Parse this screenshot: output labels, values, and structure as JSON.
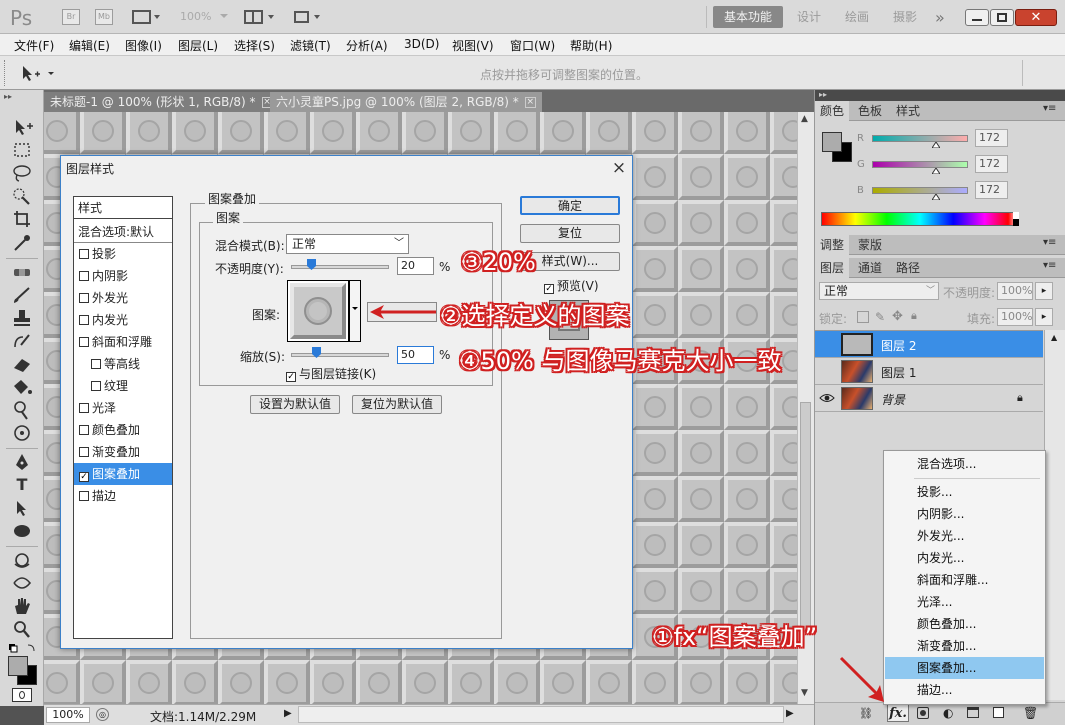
{
  "app": {
    "logo": "Ps",
    "top_buttons": [
      "Br",
      "Mb"
    ],
    "zoom_combo": "100%",
    "workspaces": [
      "基本功能",
      "设计",
      "绘画",
      "摄影"
    ],
    "workspace_more": "»"
  },
  "menu": [
    "文件(F)",
    "编辑(E)",
    "图像(I)",
    "图层(L)",
    "选择(S)",
    "滤镜(T)",
    "分析(A)",
    "3D(D)",
    "视图(V)",
    "窗口(W)",
    "帮助(H)"
  ],
  "options_bar": {
    "hint": "点按并拖移可调整图案的位置。"
  },
  "doc_tabs": [
    {
      "label": "未标题-1 @ 100% (形状 1, RGB/8) *",
      "close": "×"
    },
    {
      "label": "六小灵童PS.jpg @ 100% (图层 2, RGB/8) *",
      "close": "×"
    }
  ],
  "status": {
    "zoom": "100%",
    "doc": "文档:1.14M/2.29M"
  },
  "color_panel": {
    "tabs": [
      "颜色",
      "色板",
      "样式"
    ],
    "channels": [
      {
        "label": "R",
        "value": "172",
        "position": 0.67
      },
      {
        "label": "G",
        "value": "172",
        "position": 0.67
      },
      {
        "label": "B",
        "value": "172",
        "position": 0.67
      }
    ],
    "colors": {
      "foreground": "#acacac",
      "background": "#000000"
    }
  },
  "adjust_panel": {
    "tabs": [
      "调整",
      "蒙版"
    ]
  },
  "layers_panel": {
    "tabs": [
      "图层",
      "通道",
      "路径"
    ],
    "blend_mode": "正常",
    "opacity_label": "不透明度:",
    "opacity": "100%",
    "lock_label": "锁定:",
    "fill_label": "填充:",
    "fill": "100%",
    "layers": [
      {
        "name": "图层 2",
        "selected": true
      },
      {
        "name": "图层 1",
        "selected": false
      },
      {
        "name": "背景",
        "selected": false
      }
    ],
    "fx_label": "fx."
  },
  "context_menu": {
    "items": [
      "混合选项...",
      "投影...",
      "内阴影...",
      "外发光...",
      "内发光...",
      "斜面和浮雕...",
      "光泽...",
      "颜色叠加...",
      "渐变叠加...",
      "图案叠加...",
      "描边..."
    ],
    "highlighted": "图案叠加..."
  },
  "dialog": {
    "title": "图层样式",
    "close": "×",
    "styles_header": "样式",
    "styles": [
      {
        "label": "混合选项:默认",
        "check": false,
        "indent": 0
      },
      {
        "label": "投影",
        "check": true,
        "indent": 0
      },
      {
        "label": "内阴影",
        "check": true,
        "indent": 0
      },
      {
        "label": "外发光",
        "check": true,
        "indent": 0
      },
      {
        "label": "内发光",
        "check": true,
        "indent": 0
      },
      {
        "label": "斜面和浮雕",
        "check": true,
        "indent": 0
      },
      {
        "label": "等高线",
        "check": true,
        "indent": 1
      },
      {
        "label": "纹理",
        "check": true,
        "indent": 1
      },
      {
        "label": "光泽",
        "check": true,
        "indent": 0
      },
      {
        "label": "颜色叠加",
        "check": true,
        "indent": 0
      },
      {
        "label": "渐变叠加",
        "check": true,
        "indent": 0
      },
      {
        "label": "图案叠加",
        "check": true,
        "indent": 0,
        "checked": true,
        "selected": true
      },
      {
        "label": "描边",
        "check": true,
        "indent": 0
      }
    ],
    "group_title": "图案叠加",
    "sub_group": "图案",
    "blend_label": "混合模式(B):",
    "blend_value": "正常",
    "opacity_label": "不透明度(Y):",
    "opacity_value": "20",
    "opacity_unit": "%",
    "opacity_pct": 0.2,
    "pattern_label": "图案:",
    "scale_label": "缩放(S):",
    "scale_value": "50",
    "scale_unit": "%",
    "scale_pct": 0.25,
    "link_label": "与图层链接(K)",
    "set_default": "设置为默认值",
    "reset_default": "复位为默认值",
    "ok": "确定",
    "reset": "复位",
    "new_style": "样式(W)...",
    "preview": "预览(V)"
  },
  "annotations": {
    "a1": "①fx“图案叠加”",
    "a2": "②选择定义的图案",
    "a3": "③20%",
    "a4": "④50% 与图像马赛克大小一致"
  }
}
